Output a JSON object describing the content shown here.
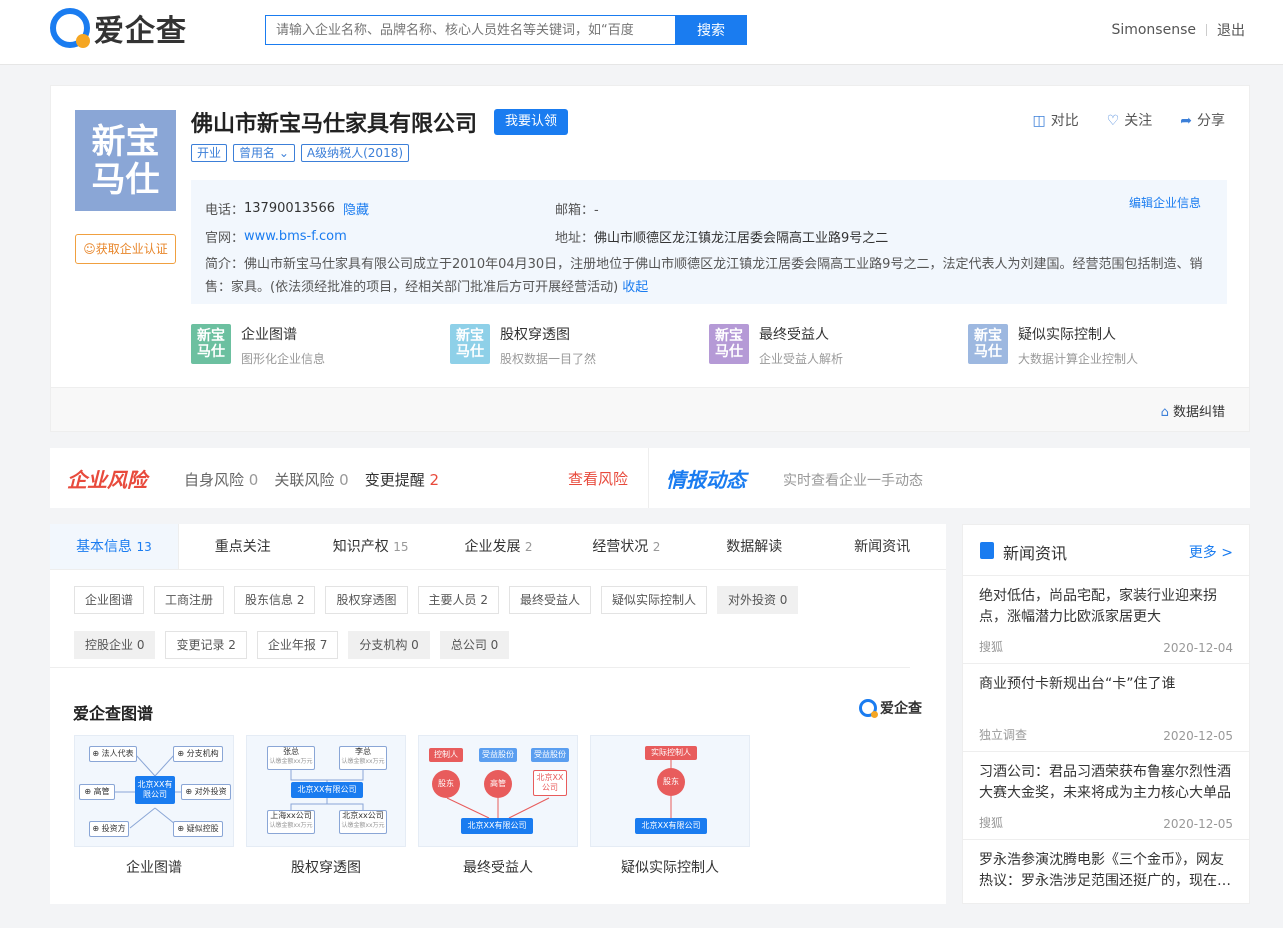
{
  "header": {
    "logo_text": "爱企查",
    "search_placeholder": "请输入企业名称、品牌名称、核心人员姓名等关键词，如“百度",
    "search_button": "搜索",
    "username": "Simonsense",
    "logout": "退出"
  },
  "company": {
    "logo_text_1": "新宝",
    "logo_text_2": "马仕",
    "name": "佛山市新宝马仕家具有限公司",
    "claim_button": "我要认领",
    "get_cert": "获取企业认证",
    "tags": [
      "开业",
      "曾用名",
      "A级纳税人(2018)"
    ],
    "actions": [
      {
        "icon": "compare-icon",
        "glyph": "◫",
        "label": "对比"
      },
      {
        "icon": "heart-icon",
        "glyph": "♡",
        "label": "关注"
      },
      {
        "icon": "share-icon",
        "glyph": "➦",
        "label": "分享"
      }
    ],
    "phone_label": "电话：",
    "phone": "13790013566",
    "phone_hide": "隐藏",
    "email_label": "邮箱：",
    "email": "-",
    "edit_link": "编辑企业信息",
    "website_label": "官网：",
    "website": "www.bms-f.com",
    "address_label": "地址：",
    "address": "佛山市顺德区龙江镇龙江居委会隔高工业路9号之二",
    "intro_label": "简介：",
    "intro": "佛山市新宝马仕家具有限公司成立于2010年04月30日，注册地位于佛山市顺德区龙江镇龙江居委会隔高工业路9号之二，法定代表人为刘建国。经营范围包括制造、销售：家具。(依法须经批准的项目，经相关部门批准后方可开展经营活动)",
    "intro_collapse": "收起",
    "tiles": [
      {
        "title": "企业图谱",
        "sub": "图形化企业信息",
        "color": "#6cc0a0"
      },
      {
        "title": "股权穿透图",
        "sub": "股权数据一目了然",
        "color": "#8ed0e8"
      },
      {
        "title": "最终受益人",
        "sub": "企业受益人解析",
        "color": "#b59ad6"
      },
      {
        "title": "疑似实际控制人",
        "sub": "大数据计算企业控制人",
        "color": "#9db8e0"
      }
    ],
    "data_fix": "数据纠错"
  },
  "risk": {
    "title": "企业风险",
    "items": [
      {
        "label": "自身风险",
        "count": "0"
      },
      {
        "label": "关联风险",
        "count": "0"
      },
      {
        "label": "变更提醒",
        "count": "2"
      }
    ],
    "view": "查看风险",
    "intel_title": "情报动态",
    "intel_sub": "实时查看企业一手动态"
  },
  "tabs": [
    {
      "label": "基本信息",
      "count": "13"
    },
    {
      "label": "重点关注",
      "count": ""
    },
    {
      "label": "知识产权",
      "count": "15"
    },
    {
      "label": "企业发展",
      "count": "2"
    },
    {
      "label": "经营状况",
      "count": "2"
    },
    {
      "label": "数据解读",
      "count": ""
    },
    {
      "label": "新闻资讯",
      "count": ""
    }
  ],
  "chips": [
    "企业图谱",
    "工商注册",
    "股东信息 2",
    "股权穿透图",
    "主要人员 2",
    "最终受益人",
    "疑似实际控制人",
    "对外投资 0",
    "控股企业 0",
    "变更记录 2",
    "企业年报 7",
    "分支机构 0",
    "总公司 0"
  ],
  "graph_section": {
    "title": "爱企查图谱",
    "logo_text": "爱企查",
    "cards": [
      {
        "caption": "企业图谱",
        "center": "北京XX有限公司",
        "nodes": [
          "法人代表",
          "分支机构",
          "高管",
          "对外投资",
          "投资方",
          "疑似控股"
        ]
      },
      {
        "caption": "股权穿透图",
        "top": [
          "张总",
          "李总"
        ],
        "top_sub": "认缴金额xx万元",
        "center": "北京XX有限公司",
        "bottom": [
          "上海xx公司",
          "北京xx公司"
        ]
      },
      {
        "caption": "最终受益人",
        "top": [
          "控制人",
          "受益股份",
          "受益股份"
        ],
        "mid": [
          "股东",
          "高管",
          "北京XX公司"
        ],
        "center": "北京XX有限公司"
      },
      {
        "caption": "疑似实际控制人",
        "top": "实际控制人",
        "mid": "股东",
        "center": "北京XX有限公司"
      }
    ]
  },
  "news": {
    "title": "新闻资讯",
    "more": "更多 >",
    "items": [
      {
        "title": "绝对低估，尚品宅配，家装行业迎来拐点，涨幅潜力比欧派家居更大",
        "source": "搜狐",
        "date": "2020-12-04"
      },
      {
        "title": "商业预付卡新规出台“卡”住了谁",
        "source": "独立调查",
        "date": "2020-12-05"
      },
      {
        "title": "习酒公司：君品习酒荣获布鲁塞尔烈性酒大赛大金奖，未来将成为主力核心大单品",
        "source": "搜狐",
        "date": "2020-12-05"
      },
      {
        "title": "罗永浩参演沈腾电影《三个金币》，网友热议：罗永浩涉足范围还挺广的，现在…",
        "source": "",
        "date": ""
      }
    ]
  }
}
